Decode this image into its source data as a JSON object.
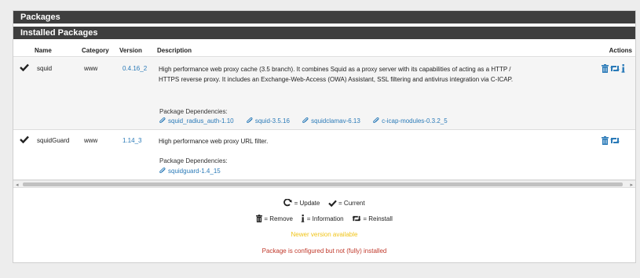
{
  "panel": {
    "title": "Packages"
  },
  "section": {
    "title": "Installed Packages"
  },
  "table": {
    "headers": {
      "name": "Name",
      "category": "Category",
      "version": "Version",
      "description": "Description",
      "actions": "Actions"
    },
    "rows": [
      {
        "name": "squid",
        "category": "www",
        "version": "0.4.16_2",
        "description_line1": "High performance web proxy cache (3.5 branch). It combines Squid as a proxy server with its capabilities of acting as a HTTP /",
        "description_line2": "HTTPS reverse proxy. It includes an Exchange-Web-Access (OWA) Assistant, SSL filtering and antivirus integration via C-ICAP.",
        "deps_label": "Package Dependencies:",
        "deps": [
          "squid_radius_auth-1.10",
          "squid-3.5.16",
          "squidclamav-6.13",
          "c-icap-modules-0.3.2_5"
        ]
      },
      {
        "name": "squidGuard",
        "category": "www",
        "version": "1.14_3",
        "description_line1": "High performance web proxy URL filter.",
        "deps_label": "Package Dependencies:",
        "deps": [
          "squidguard-1.4_15"
        ]
      }
    ]
  },
  "legend": {
    "update": "= Update",
    "current": "= Current",
    "remove": "= Remove",
    "information": "= Information",
    "reinstall": "= Reinstall",
    "newer": "Newer version available",
    "not_installed": "Package is configured but not (fully) installed"
  },
  "colors": {
    "header_bar": "#3e3e3e",
    "link": "#2a7ab8",
    "newer": "#f0c419",
    "error": "#c0392b"
  }
}
